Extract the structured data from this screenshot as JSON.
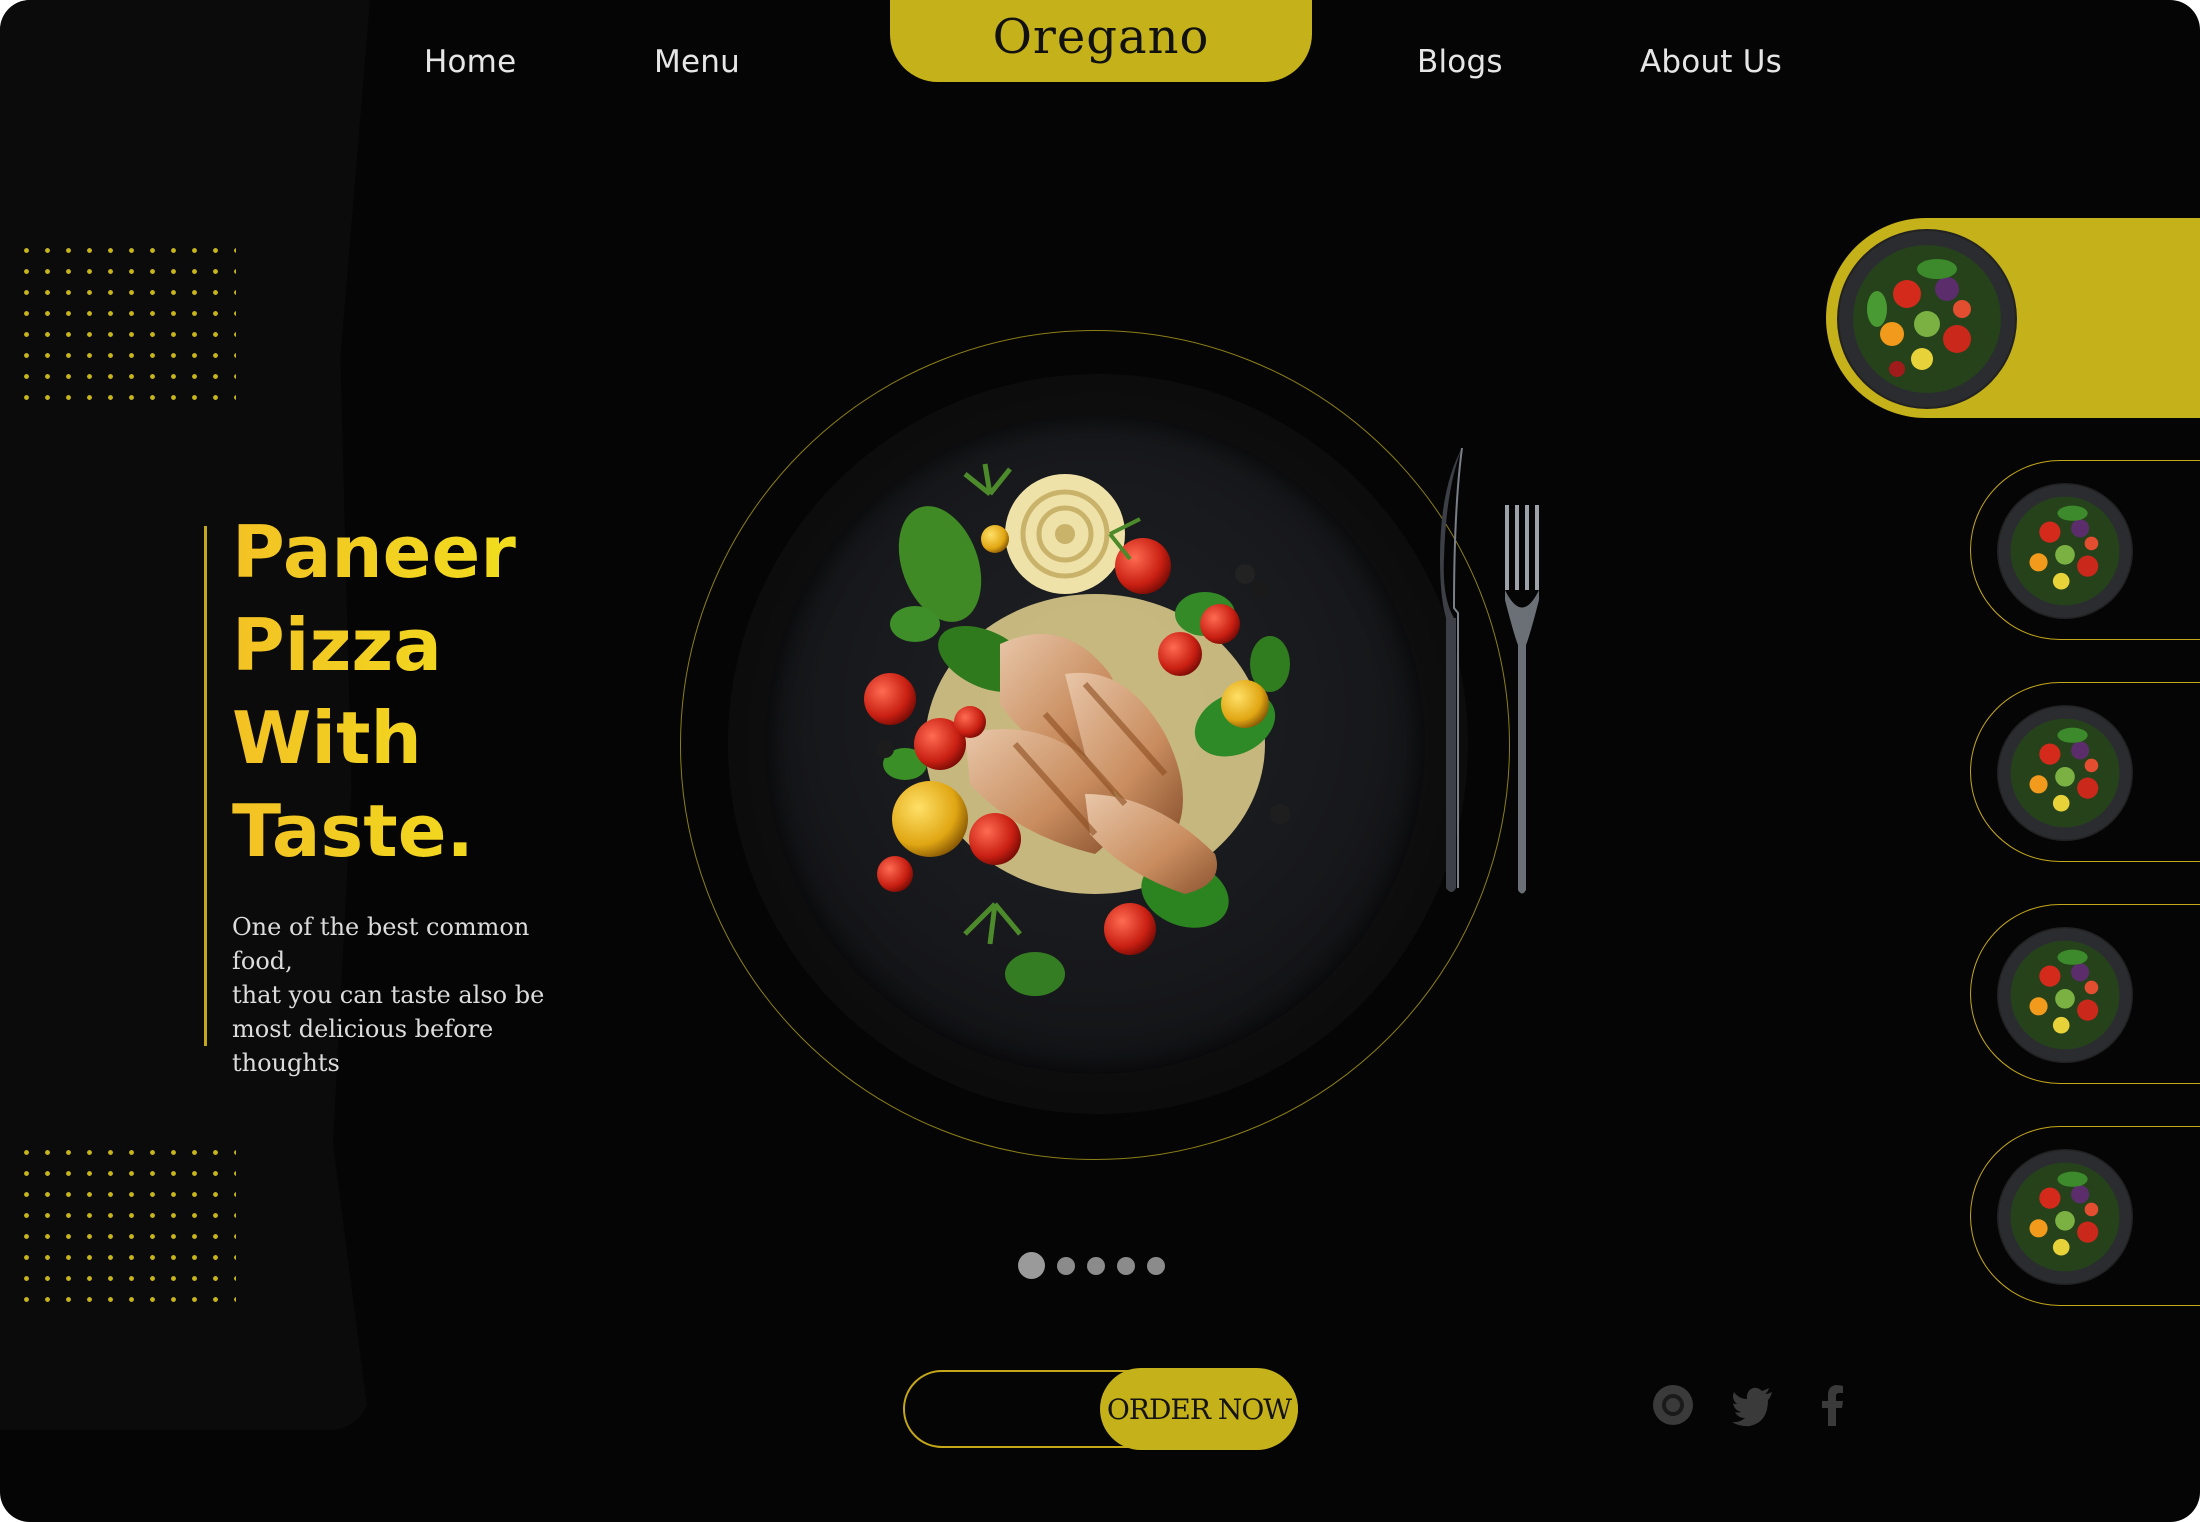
{
  "brand": {
    "logo": "Oregano",
    "accent": "#c5b11a",
    "headline_color": "#f2cd1d"
  },
  "nav": {
    "home": "Home",
    "menu": "Menu",
    "blogs": "Blogs",
    "about": "About Us"
  },
  "hero": {
    "title_lines": [
      "Paneer",
      "Pizza",
      "With",
      "Taste."
    ],
    "description_lines": [
      "One of the best common food,",
      "that you can taste also be",
      "most delicious before",
      "thoughts"
    ]
  },
  "carousel": {
    "slide_count": 5,
    "active_index": 0
  },
  "cta": {
    "order_label": "ORDER NOW"
  },
  "social": {
    "icons": [
      "instagram-icon",
      "twitter-icon",
      "facebook-icon"
    ]
  },
  "side_menu": {
    "items": 5,
    "active_index": 0,
    "thumb_icon": "salad-bowl"
  },
  "main_dish_icon": "pasta-chicken-salad-plate"
}
